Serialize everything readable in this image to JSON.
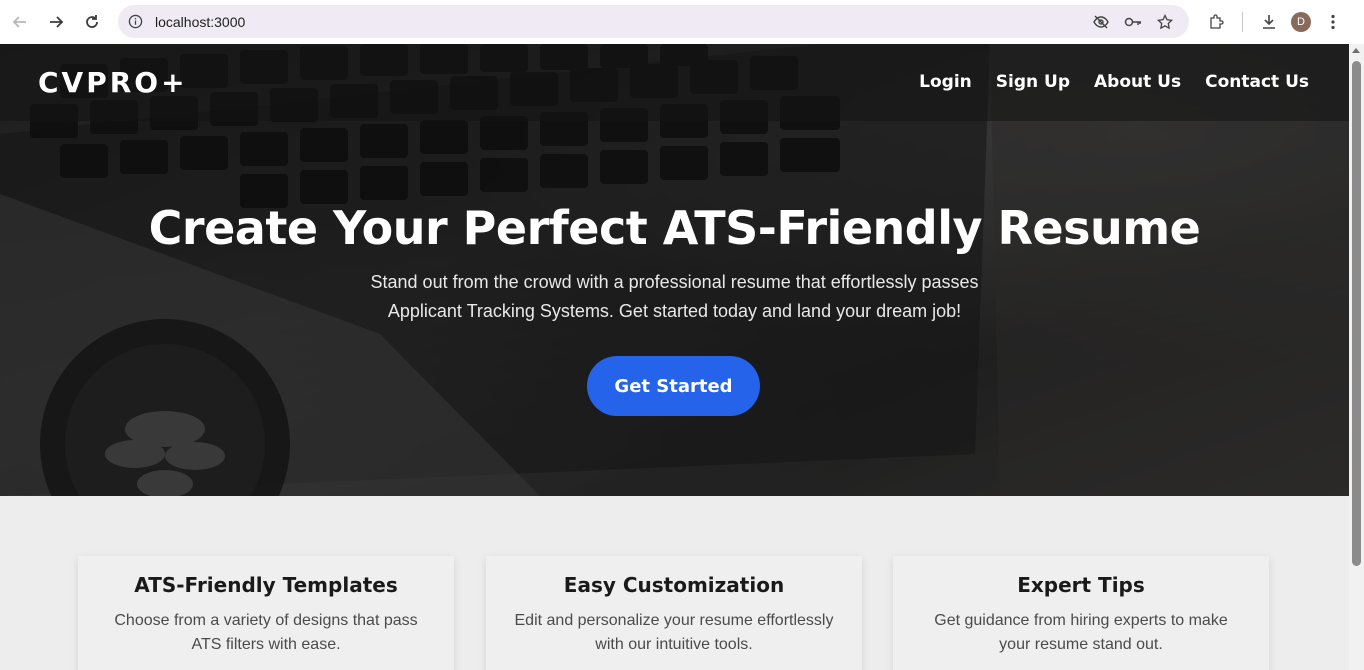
{
  "browser": {
    "url": "localhost:3000",
    "profile_initial": "D",
    "icons": {
      "back": "arrow-left-icon",
      "forward": "arrow-right-icon",
      "reload": "reload-icon",
      "site_info": "site-info-icon",
      "eye_off": "eye-off-icon",
      "password": "key-icon",
      "bookmark": "star-icon",
      "extensions": "puzzle-icon",
      "downloads": "download-icon",
      "menu": "kebab-menu-icon"
    }
  },
  "header": {
    "logo": "CVPRO+",
    "nav": [
      {
        "label": "Login"
      },
      {
        "label": "Sign Up"
      },
      {
        "label": "About Us"
      },
      {
        "label": "Contact Us"
      }
    ]
  },
  "hero": {
    "title": "Create Your Perfect ATS-Friendly Resume",
    "subtitle_line1": "Stand out from the crowd with a professional resume that effortlessly passes",
    "subtitle_line2": "Applicant Tracking Systems. Get started today and land your dream job!",
    "cta_label": "Get Started"
  },
  "features": [
    {
      "title": "ATS-Friendly Templates",
      "desc_line1": "Choose from a variety of designs that pass",
      "desc_line2": "ATS filters with ease."
    },
    {
      "title": "Easy Customization",
      "desc_line1": "Edit and personalize your resume effortlessly",
      "desc_line2": "with our intuitive tools."
    },
    {
      "title": "Expert Tips",
      "desc_line1": "Get guidance from hiring experts to make",
      "desc_line2": "your resume stand out."
    }
  ],
  "colors": {
    "accent": "#2563eb",
    "hero_text": "#ffffff",
    "feature_bg": "#ededed"
  }
}
